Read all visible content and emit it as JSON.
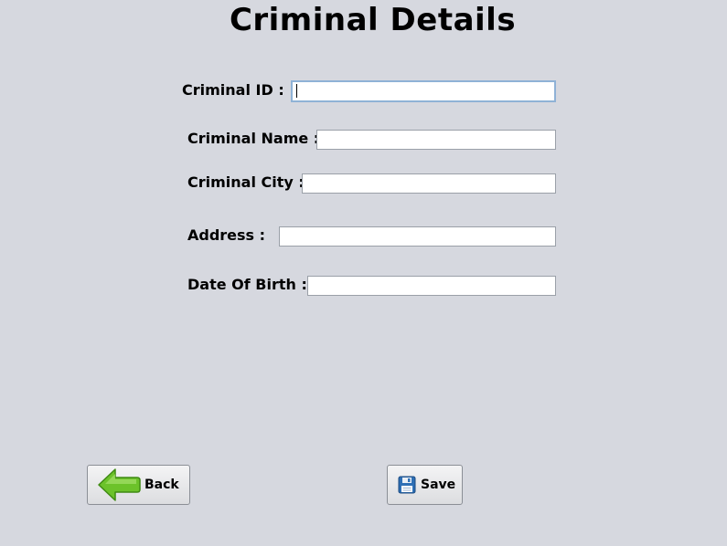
{
  "page": {
    "title": "Criminal Details"
  },
  "form": {
    "criminal_id": {
      "label": "Criminal ID :",
      "value": ""
    },
    "criminal_name": {
      "label": "Criminal Name :",
      "value": ""
    },
    "criminal_city": {
      "label": "Criminal City :",
      "value": ""
    },
    "address": {
      "label": "Address :",
      "value": ""
    },
    "date_of_birth": {
      "label": "Date Of Birth :",
      "value": ""
    }
  },
  "buttons": {
    "back_label": "Back",
    "save_label": "Save"
  },
  "icons": {
    "back": "back-arrow-icon",
    "save": "floppy-disk-icon"
  },
  "colors": {
    "background": "#d6d8df",
    "focus_border": "#8fb2d6",
    "back_arrow": "#6cc22a",
    "save_icon": "#2d6fb5"
  }
}
